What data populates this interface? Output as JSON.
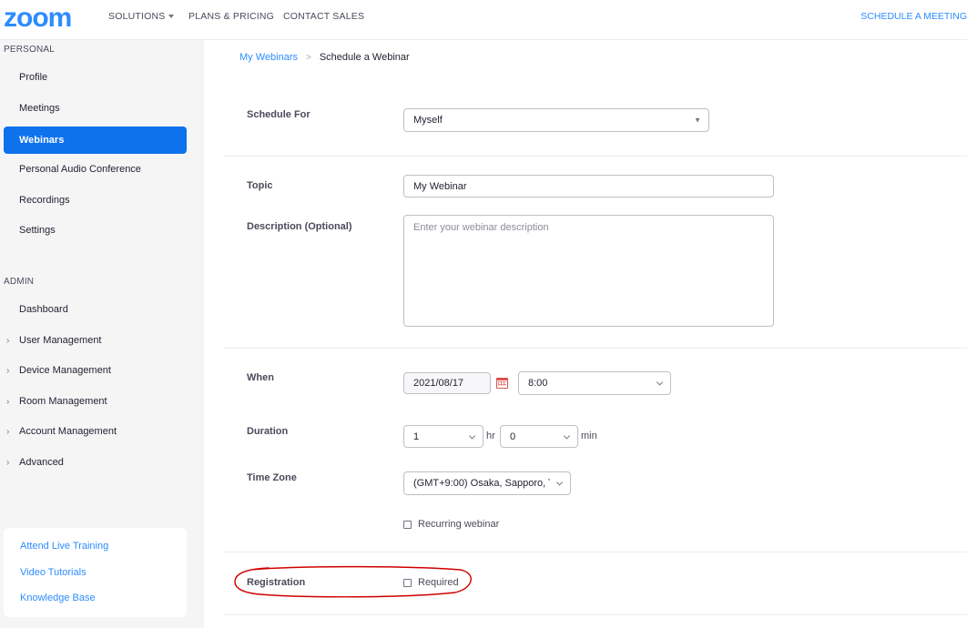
{
  "header": {
    "logo": "zoom",
    "nav": [
      "SOLUTIONS",
      "PLANS & PRICING",
      "CONTACT SALES"
    ],
    "schedule_meeting": "SCHEDULE A MEETING"
  },
  "sidebar": {
    "personal_title": "PERSONAL",
    "personal_items": [
      "Profile",
      "Meetings",
      "Webinars",
      "Personal Audio Conference",
      "Recordings",
      "Settings"
    ],
    "admin_title": "ADMIN",
    "admin_items": [
      "Dashboard",
      "User Management",
      "Device Management",
      "Room Management",
      "Account Management",
      "Advanced"
    ],
    "help_links": [
      "Attend Live Training",
      "Video Tutorials",
      "Knowledge Base"
    ]
  },
  "breadcrumb": {
    "parent": "My Webinars",
    "separator": ">",
    "current": "Schedule a Webinar"
  },
  "form": {
    "schedule_for": {
      "label": "Schedule For",
      "value": "Myself"
    },
    "topic": {
      "label": "Topic",
      "value": "My Webinar"
    },
    "description": {
      "label": "Description (Optional)",
      "placeholder": "Enter your webinar description"
    },
    "when": {
      "label": "When",
      "date": "2021/08/17",
      "time": "8:00"
    },
    "duration": {
      "label": "Duration",
      "hours": "1",
      "hr_unit": "hr",
      "minutes": "0",
      "min_unit": "min"
    },
    "time_zone": {
      "label": "Time Zone",
      "value": "(GMT+9:00) Osaka, Sapporo, T"
    },
    "recurring": {
      "label": "Recurring webinar",
      "checked": false
    },
    "registration": {
      "label": "Registration",
      "checkbox_label": "Required",
      "checked": false
    }
  },
  "colors": {
    "brand": "#2d8cff",
    "active_nav": "#0e72ed",
    "annotation": "#d10000"
  },
  "icons": {
    "select_arrow": "triangle-down-icon",
    "dropdown": "chevron-down-icon",
    "calendar": "calendar-icon",
    "expand": "chevron-right-icon"
  }
}
